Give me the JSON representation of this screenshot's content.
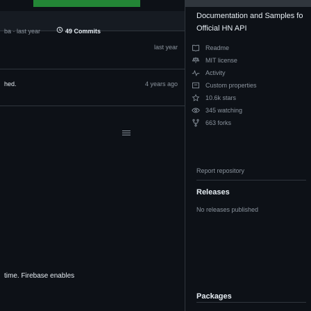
{
  "left": {
    "commit_prefix": "ba · last year",
    "commit_count": "49 Commits",
    "rows": [
      {
        "name": "",
        "time": "last year"
      },
      {
        "name": "hed.",
        "time": "4 years ago"
      }
    ],
    "footer_text": "time. Firebase enables"
  },
  "right": {
    "title": "Documentation and Samples fo",
    "subtitle": "Official HN API",
    "items": [
      {
        "icon": "book-icon",
        "label": "Readme"
      },
      {
        "icon": "law-icon",
        "label": "MIT license"
      },
      {
        "icon": "pulse-icon",
        "label": "Activity"
      },
      {
        "icon": "custom-properties-icon",
        "label": "Custom properties"
      },
      {
        "icon": "star-icon",
        "label": "10.6k stars"
      },
      {
        "icon": "eye-icon",
        "label": "345 watching"
      },
      {
        "icon": "fork-icon",
        "label": "663 forks"
      }
    ],
    "report": "Report repository",
    "releases_title": "Releases",
    "releases_text": "No releases published",
    "packages_title": "Packages"
  },
  "colors": {
    "bg": "#0d1117",
    "text": "#e6edf3",
    "muted": "#8b949e",
    "border": "#30363d",
    "accent": "#238636"
  }
}
